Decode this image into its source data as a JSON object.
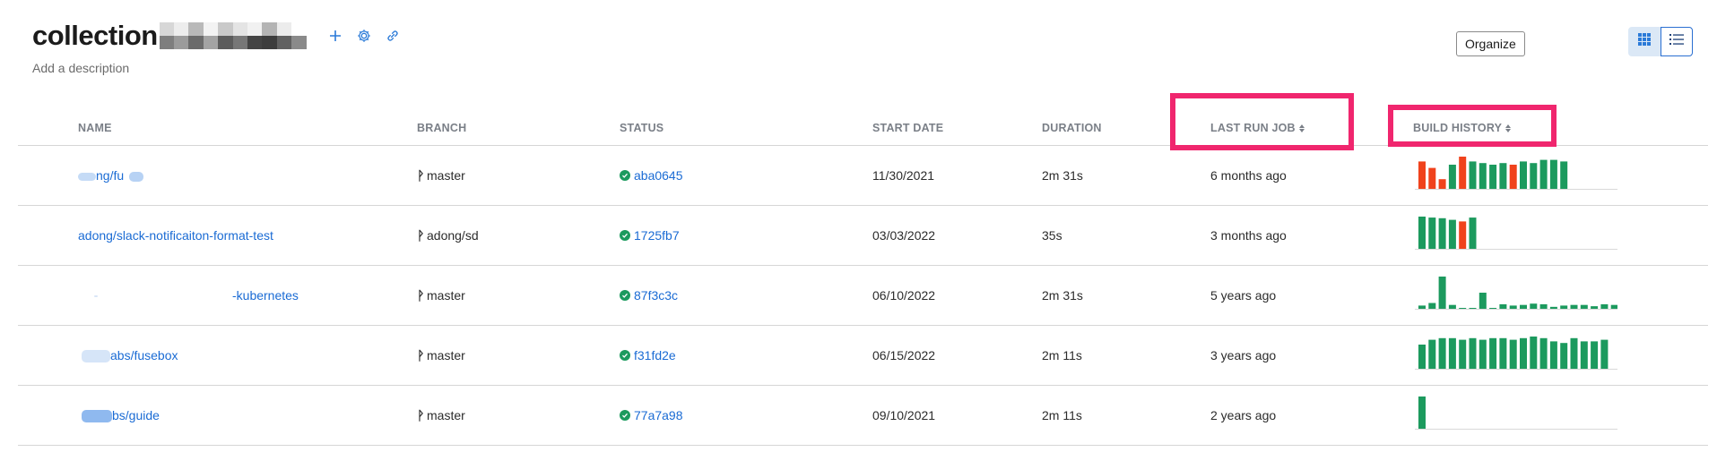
{
  "header": {
    "title": "collection",
    "description": "Add a description",
    "actions": [
      {
        "name": "add",
        "icon": "plus-icon"
      },
      {
        "name": "settings",
        "icon": "gear-icon"
      },
      {
        "name": "link",
        "icon": "link-icon"
      }
    ]
  },
  "toolbar": {
    "organize_label": "Organize",
    "views": [
      {
        "name": "grid",
        "icon": "grid-view-icon",
        "active": false
      },
      {
        "name": "list",
        "icon": "list-view-icon",
        "active": true
      }
    ]
  },
  "columns": {
    "name": "NAME",
    "branch": "BRANCH",
    "status": "STATUS",
    "start_date": "START DATE",
    "duration": "DURATION",
    "last_run_job": "LAST RUN JOB",
    "build_history": "BUILD HISTORY"
  },
  "colors": {
    "link": "#1a6bd4",
    "success": "#1c9a5e",
    "failure": "#f0421c",
    "highlight": "#f0266e"
  },
  "rows": [
    {
      "name": "ng/fu",
      "branch": "master",
      "commit": "aba0645",
      "start_date": "11/30/2021",
      "duration": "2m 31s",
      "last_run": "6 months ago",
      "history": [
        {
          "v": 0.85,
          "s": "fail"
        },
        {
          "v": 0.65,
          "s": "fail"
        },
        {
          "v": 0.3,
          "s": "fail"
        },
        {
          "v": 0.75,
          "s": "pass"
        },
        {
          "v": 1.0,
          "s": "fail"
        },
        {
          "v": 0.85,
          "s": "pass"
        },
        {
          "v": 0.8,
          "s": "pass"
        },
        {
          "v": 0.75,
          "s": "pass"
        },
        {
          "v": 0.8,
          "s": "pass"
        },
        {
          "v": 0.75,
          "s": "fail"
        },
        {
          "v": 0.85,
          "s": "pass"
        },
        {
          "v": 0.8,
          "s": "pass"
        },
        {
          "v": 0.9,
          "s": "pass"
        },
        {
          "v": 0.9,
          "s": "pass"
        },
        {
          "v": 0.85,
          "s": "pass"
        }
      ]
    },
    {
      "name": "adong/slack-notificaiton-format-test",
      "branch": "adong/sd",
      "commit": "1725fb7",
      "start_date": "03/03/2022",
      "duration": "35s",
      "last_run": "3 months ago",
      "history": [
        {
          "v": 1.0,
          "s": "pass"
        },
        {
          "v": 0.97,
          "s": "pass"
        },
        {
          "v": 0.95,
          "s": "pass"
        },
        {
          "v": 0.9,
          "s": "pass"
        },
        {
          "v": 0.85,
          "s": "fail"
        },
        {
          "v": 0.97,
          "s": "pass"
        }
      ]
    },
    {
      "name": "-kubernetes",
      "branch": "master",
      "commit": "87f3c3c",
      "start_date": "06/10/2022",
      "duration": "2m 31s",
      "last_run": "5 years ago",
      "history": [
        {
          "v": 0.1,
          "s": "pass"
        },
        {
          "v": 0.18,
          "s": "pass"
        },
        {
          "v": 1.0,
          "s": "pass"
        },
        {
          "v": 0.12,
          "s": "pass"
        },
        {
          "v": 0.0,
          "s": "pass"
        },
        {
          "v": 0.0,
          "s": "pass"
        },
        {
          "v": 0.5,
          "s": "pass"
        },
        {
          "v": 0.0,
          "s": "pass"
        },
        {
          "v": 0.14,
          "s": "pass"
        },
        {
          "v": 0.1,
          "s": "pass"
        },
        {
          "v": 0.12,
          "s": "pass"
        },
        {
          "v": 0.16,
          "s": "pass"
        },
        {
          "v": 0.14,
          "s": "pass"
        },
        {
          "v": 0.06,
          "s": "pass"
        },
        {
          "v": 0.1,
          "s": "pass"
        },
        {
          "v": 0.12,
          "s": "pass"
        },
        {
          "v": 0.12,
          "s": "pass"
        },
        {
          "v": 0.08,
          "s": "pass"
        },
        {
          "v": 0.14,
          "s": "pass"
        },
        {
          "v": 0.12,
          "s": "pass"
        }
      ]
    },
    {
      "name": "abs/fusebox",
      "branch": "master",
      "commit": "f31fd2e",
      "start_date": "06/15/2022",
      "duration": "2m 11s",
      "last_run": "3 years ago",
      "history": [
        {
          "v": 0.75,
          "s": "pass"
        },
        {
          "v": 0.9,
          "s": "pass"
        },
        {
          "v": 0.95,
          "s": "pass"
        },
        {
          "v": 0.95,
          "s": "pass"
        },
        {
          "v": 0.9,
          "s": "pass"
        },
        {
          "v": 0.95,
          "s": "pass"
        },
        {
          "v": 0.9,
          "s": "pass"
        },
        {
          "v": 0.95,
          "s": "pass"
        },
        {
          "v": 0.95,
          "s": "pass"
        },
        {
          "v": 0.9,
          "s": "pass"
        },
        {
          "v": 0.95,
          "s": "pass"
        },
        {
          "v": 1.0,
          "s": "pass"
        },
        {
          "v": 0.95,
          "s": "pass"
        },
        {
          "v": 0.85,
          "s": "pass"
        },
        {
          "v": 0.8,
          "s": "pass"
        },
        {
          "v": 0.95,
          "s": "pass"
        },
        {
          "v": 0.85,
          "s": "pass"
        },
        {
          "v": 0.85,
          "s": "pass"
        },
        {
          "v": 0.9,
          "s": "pass"
        }
      ]
    },
    {
      "name": "bs/guide",
      "branch": "master",
      "commit": "77a7a98",
      "start_date": "09/10/2021",
      "duration": "2m 11s",
      "last_run": "2 years ago",
      "history": [
        {
          "v": 1.0,
          "s": "pass"
        }
      ]
    }
  ]
}
